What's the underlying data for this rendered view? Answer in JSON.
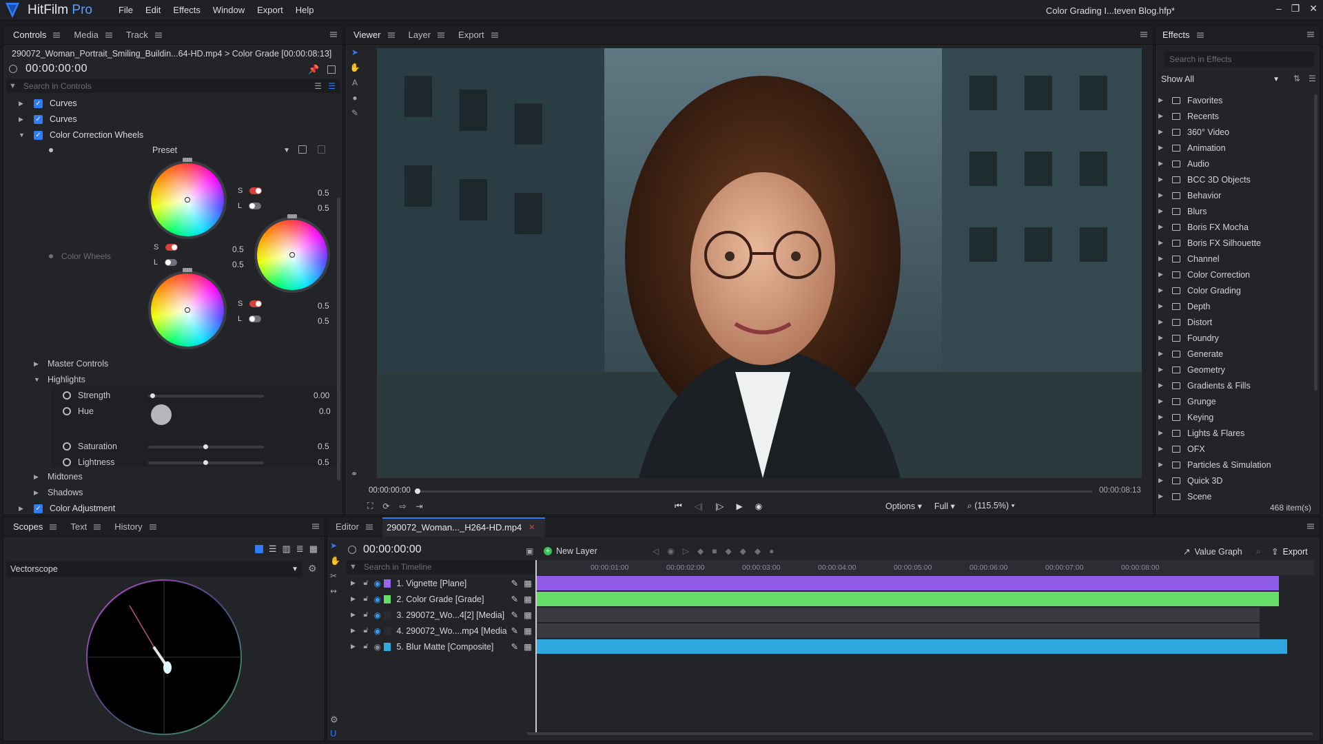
{
  "app": {
    "name": "HitFilm",
    "edition": "Pro",
    "document_title": "Color Grading I...teven Blog.hfp*"
  },
  "menu": [
    "File",
    "Edit",
    "Effects",
    "Window",
    "Export",
    "Help"
  ],
  "window_buttons": [
    "–",
    "❐",
    "✕"
  ],
  "controls_panel": {
    "tabs": [
      "Controls",
      "Media",
      "Track"
    ],
    "breadcrumb": "290072_Woman_Portrait_Smiling_Buildin...64-HD.mp4 > Color Grade [00:00:08:13]",
    "timecode": "00:00:00:00",
    "search_placeholder": "Search in Controls",
    "effects": [
      {
        "label": "Curves",
        "expanded": false
      },
      {
        "label": "Curves",
        "expanded": false
      },
      {
        "label": "Color Correction Wheels",
        "expanded": true
      }
    ],
    "preset_label": "Preset",
    "color_wheels_label": "Color Wheels",
    "wheels": [
      {
        "s_label": "S",
        "s_value": "0.5",
        "l_label": "L",
        "l_value": "0.5"
      },
      {
        "s_label": "S",
        "s_value": "0.5",
        "l_label": "L",
        "l_value": "0.5"
      },
      {
        "s_label": "S",
        "s_value": "0.5",
        "l_label": "L",
        "l_value": "0.5"
      }
    ],
    "sections": {
      "master": "Master Controls",
      "highlights": "Highlights",
      "midtones": "Midtones",
      "shadows": "Shadows",
      "color_adjustment": "Color Adjustment"
    },
    "highlights_params": [
      {
        "label": "Strength",
        "value": "0.00",
        "level": 0.02
      },
      {
        "label": "Hue",
        "value": "0.0"
      },
      {
        "label": "Saturation",
        "value": "0.5",
        "level": 0.5
      },
      {
        "label": "Lightness",
        "value": "0.5",
        "level": 0.5
      }
    ]
  },
  "viewer": {
    "tabs": [
      "Viewer",
      "Layer",
      "Export"
    ],
    "time_start": "00:00:00:00",
    "time_end": "00:00:08:13",
    "options_label": "Options",
    "quality_label": "Full",
    "zoom_label": "(115.5%)"
  },
  "effects_panel": {
    "tab": "Effects",
    "search_placeholder": "Search in Effects",
    "filter": "Show All",
    "folders": [
      "Favorites",
      "Recents",
      "360° Video",
      "Animation",
      "Audio",
      "BCC 3D Objects",
      "Behavior",
      "Blurs",
      "Boris FX Mocha",
      "Boris FX Silhouette",
      "Channel",
      "Color Correction",
      "Color Grading",
      "Depth",
      "Distort",
      "Foundry",
      "Generate",
      "Geometry",
      "Gradients & Fills",
      "Grunge",
      "Keying",
      "Lights & Flares",
      "OFX",
      "Particles & Simulation",
      "Quick 3D",
      "Scene"
    ],
    "count": "468 item(s)"
  },
  "scopes_panel": {
    "tabs": [
      "Scopes",
      "Text",
      "History"
    ],
    "scope_type": "Vectorscope"
  },
  "editor": {
    "tabs": [
      "Editor",
      "290072_Woman..._H264-HD.mp4"
    ],
    "timecode": "00:00:00:00",
    "new_layer_label": "New Layer",
    "value_graph_label": "Value Graph",
    "export_label": "Export",
    "search_placeholder": "Search in Timeline",
    "ruler": [
      "00:00:01:00",
      "00:00:02:00",
      "00:00:03:00",
      "00:00:04:00",
      "00:00:05:00",
      "00:00:06:00",
      "00:00:07:00",
      "00:00:08:00"
    ],
    "layers": [
      {
        "name": "1. Vignette [Plane]",
        "color": "#9966ee",
        "blend": "None",
        "visible": true
      },
      {
        "name": "2. Color Grade [Grade]",
        "color": "#66dd66",
        "blend": "None",
        "visible": true
      },
      {
        "name": "3. 290072_Wo...4[2] [Media]",
        "color": "#2a2b30",
        "blend": "4. 29...D.mp4",
        "visible": true
      },
      {
        "name": "4. 290072_Wo....mp4 [Media]",
        "color": "#2a2b30",
        "blend": "None",
        "visible": true
      },
      {
        "name": "5. Blur Matte [Composite]",
        "color": "#33aadd",
        "blend": "None",
        "visible": false
      }
    ]
  },
  "colors": {
    "accent": "#2f7cf6",
    "purple_clip": "#8f5ce8",
    "green_clip": "#66dd66",
    "blue_clip": "#2ea8df",
    "grey_clip": "#3a3b40"
  },
  "icons": [
    "select-icon",
    "hand-icon",
    "text-icon",
    "mask-icon",
    "pen-icon",
    "link-icon",
    "play-icon",
    "folder-icon",
    "gear-icon",
    "magnet-icon",
    "lock-icon",
    "eye-icon"
  ]
}
